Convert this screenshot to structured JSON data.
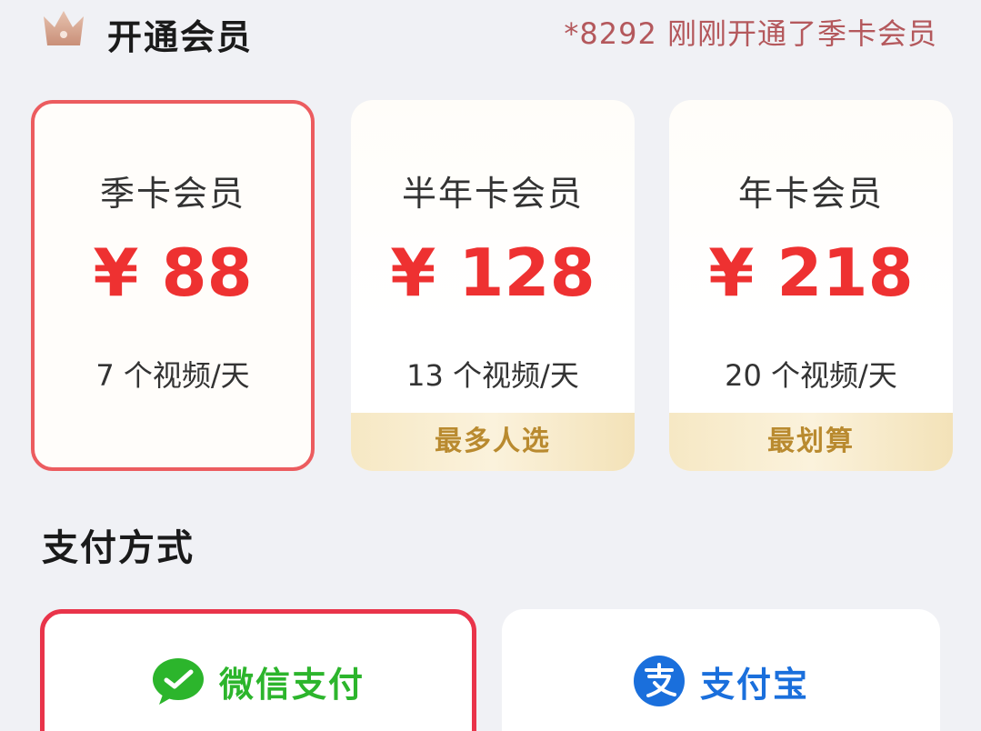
{
  "header": {
    "title": "开通会员",
    "notice": "*8292 刚刚开通了季卡会员"
  },
  "plans": [
    {
      "name": "季卡会员",
      "price": "¥ 88",
      "quota": "7 个视频/天",
      "tag": "",
      "selected": true
    },
    {
      "name": "半年卡会员",
      "price": "¥ 128",
      "quota": "13 个视频/天",
      "tag": "最多人选",
      "selected": false
    },
    {
      "name": "年卡会员",
      "price": "¥ 218",
      "quota": "20 个视频/天",
      "tag": "最划算",
      "selected": false
    }
  ],
  "payment": {
    "title": "支付方式",
    "options": [
      {
        "label": "微信支付",
        "icon": "wechat-icon",
        "selected": true
      },
      {
        "label": "支付宝",
        "icon": "alipay-icon",
        "selected": false
      }
    ]
  },
  "colors": {
    "price_red": "#ee3131",
    "selected_border": "#ec5c5f",
    "tag_gold": "#b98a2f",
    "wechat_green": "#2cb52c",
    "alipay_blue": "#1a6fdc",
    "background": "#f0f1f5"
  }
}
